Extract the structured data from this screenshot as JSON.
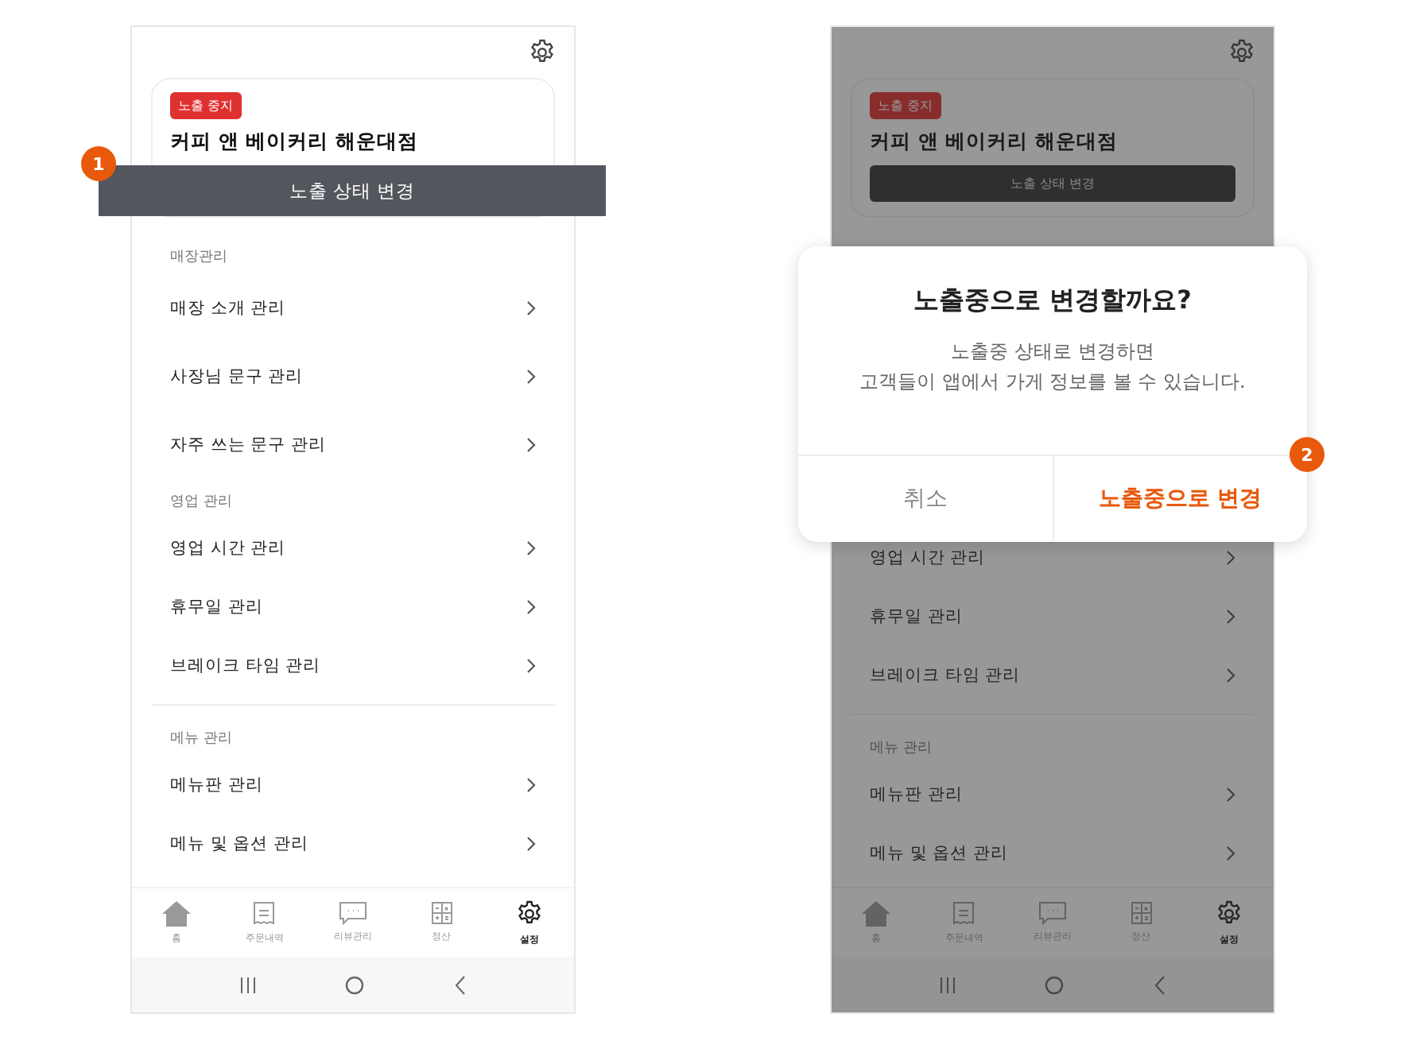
{
  "screens": [
    {
      "kind": "highlight",
      "status_badge": "노출 중지",
      "store_name": "커피 앤 베이커리 해운대점",
      "callout": {
        "number": "1",
        "label": "노출 상태 변경"
      },
      "sections": [
        {
          "label": "매장관리",
          "items": [
            "매장 소개 관리",
            "사장님 문구 관리",
            "자주 쓰는 문구 관리"
          ]
        },
        {
          "label": "영업 관리",
          "items": [
            "영업 시간 관리",
            "휴무일 관리",
            "브레이크 타임 관리"
          ]
        },
        {
          "label": "메뉴 관리",
          "items": [
            "메뉴판 관리",
            "메뉴 및 옵션 관리"
          ]
        }
      ],
      "tabs": [
        {
          "label": "홈",
          "selected": false
        },
        {
          "label": "주문내역",
          "selected": false
        },
        {
          "label": "리뷰관리",
          "selected": false
        },
        {
          "label": "정산",
          "selected": false
        },
        {
          "label": "설정",
          "selected": true
        }
      ]
    },
    {
      "kind": "dialog",
      "status_badge": "노출 중지",
      "store_name": "커피 앤 베이커리 해운대점",
      "status_button": "노출 상태 변경",
      "dialog": {
        "number": "2",
        "title": "노출중으로 변경할까요?",
        "message": "노출중 상태로 변경하면\n고객들이 앱에서 가게 정보를 볼 수 있습니다.",
        "cancel": "취소",
        "confirm": "노출중으로 변경"
      },
      "sections": [
        {
          "items": [
            "영업 시간 관리",
            "휴무일 관리",
            "브레이크 타임 관리"
          ]
        },
        {
          "label": "메뉴 관리",
          "items": [
            "메뉴판 관리",
            "메뉴 및 옵션 관리"
          ]
        }
      ],
      "tabs": [
        {
          "label": "홈",
          "selected": false
        },
        {
          "label": "주문내역",
          "selected": false
        },
        {
          "label": "리뷰관리",
          "selected": false
        },
        {
          "label": "정산",
          "selected": false
        },
        {
          "label": "설정",
          "selected": true
        }
      ]
    }
  ]
}
